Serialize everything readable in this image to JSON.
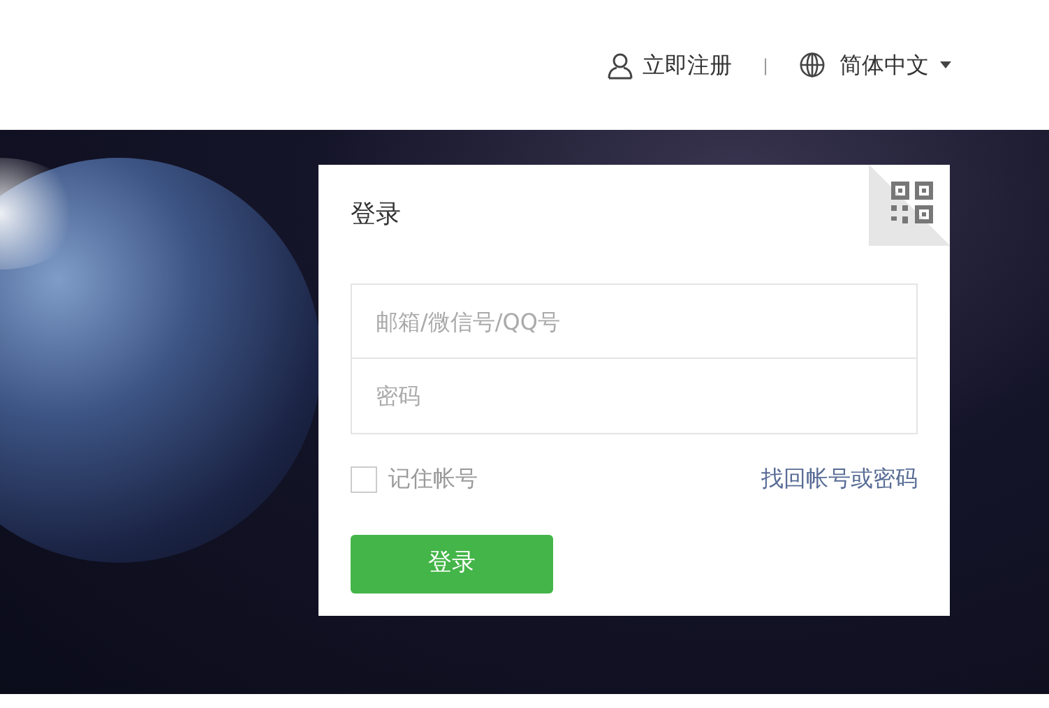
{
  "header": {
    "register_link": "立即注册",
    "separator": "|",
    "language": "简体中文"
  },
  "login_card": {
    "title": "登录",
    "fields": [
      {
        "placeholder": "邮箱/微信号/QQ号"
      },
      {
        "placeholder": "密码"
      }
    ],
    "remember": {
      "label": "记住帐号",
      "checked": false
    },
    "forgot_link": "找回帐号或密码",
    "submit": "登录"
  }
}
